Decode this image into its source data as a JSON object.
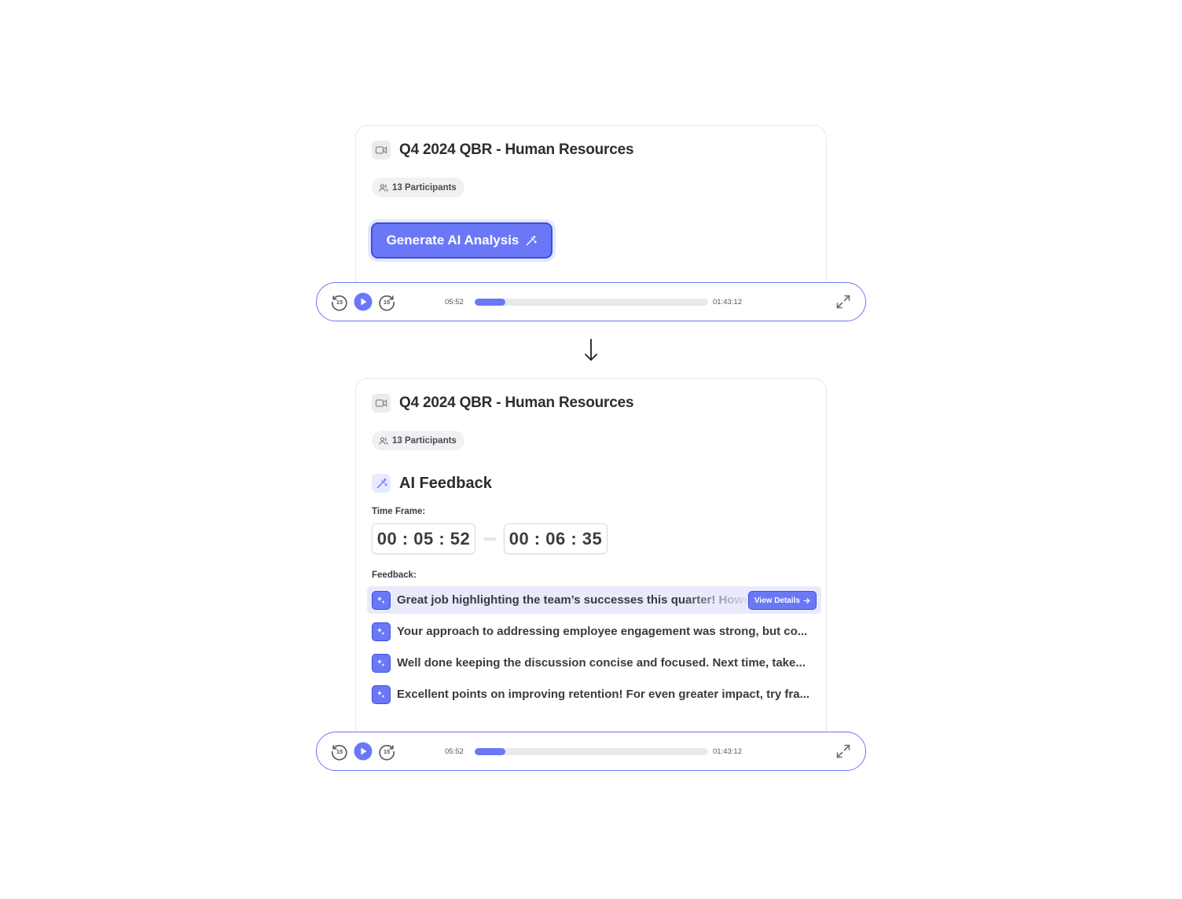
{
  "meeting": {
    "title": "Q4 2024 QBR - Human Resources",
    "participants": "13 Participants"
  },
  "generate_button": {
    "label": "Generate AI Analysis"
  },
  "player": {
    "current_time": "05:52",
    "total_time": "01:43:12",
    "progress": 0.13,
    "skip_seconds": "15",
    "accent_color": "#6a78f7"
  },
  "feedback_panel": {
    "heading": "AI Feedback",
    "time_frame_label": "Time Frame:",
    "start": {
      "h": "00",
      "m": "05",
      "s": "52"
    },
    "end": {
      "h": "00",
      "m": "06",
      "s": "35"
    },
    "feedback_label": "Feedback:",
    "items": [
      {
        "text": "Great job highlighting the team’s successes this quarter! However"
      },
      {
        "text": "Your approach to addressing employee engagement was strong, but co..."
      },
      {
        "text": "Well done keeping the discussion concise and focused. Next time, take..."
      },
      {
        "text": "Excellent points on improving retention! For even greater impact, try fra..."
      }
    ],
    "view_details_label": "View Details"
  }
}
